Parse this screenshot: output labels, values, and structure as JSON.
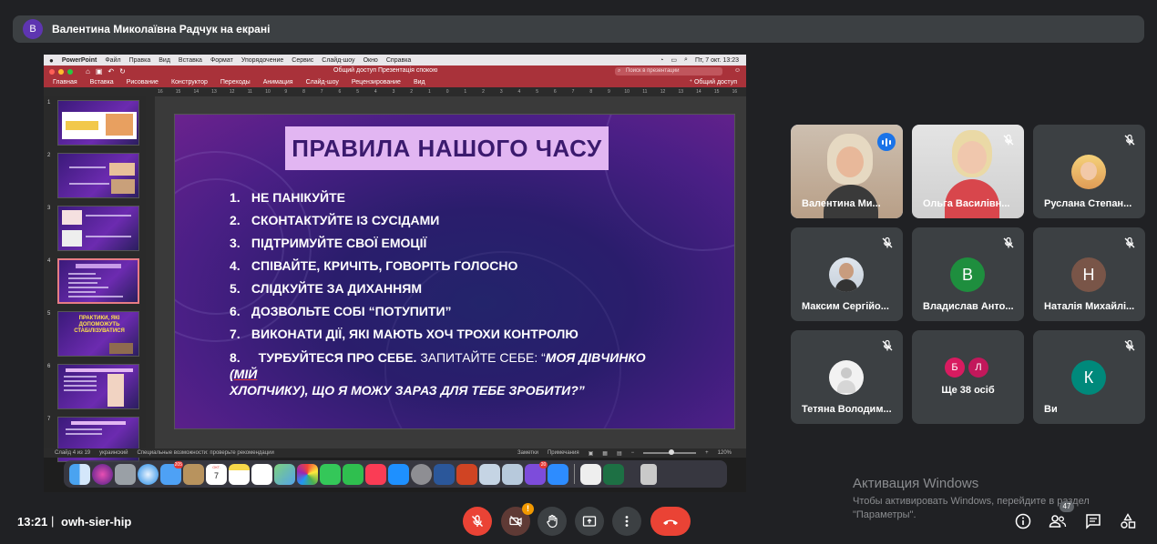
{
  "presenter": {
    "initial": "В",
    "label": "Валентина Миколаївна Радчук на екрані"
  },
  "mac_menu": {
    "app": "PowerPoint",
    "items": [
      "Файл",
      "Правка",
      "Вид",
      "Вставка",
      "Формат",
      "Упорядочение",
      "Сервис",
      "Слайд-шоу",
      "Окно",
      "Справка"
    ],
    "clock": "Пт, 7 окт. 13:23"
  },
  "ppt": {
    "doc_title": "Общий доступ Презентація спокою",
    "search_placeholder": "Поиск в презентации",
    "ribbon_tabs": [
      "Главная",
      "Вставка",
      "Рисование",
      "Конструктор",
      "Переходы",
      "Анимация",
      "Слайд-шоу",
      "Рецензирование",
      "Вид"
    ],
    "share_label": "Общий доступ",
    "ruler": [
      "16",
      "15",
      "14",
      "13",
      "12",
      "11",
      "10",
      "9",
      "8",
      "7",
      "6",
      "5",
      "4",
      "3",
      "2",
      "1",
      "0",
      "1",
      "2",
      "3",
      "4",
      "5",
      "6",
      "7",
      "8",
      "9",
      "10",
      "11",
      "12",
      "13",
      "14",
      "15",
      "16"
    ],
    "thumb_numbers": [
      "1",
      "2",
      "3",
      "4",
      "5",
      "6",
      "7"
    ],
    "thumb5_text": "ПРАКТИКИ, ЯКІ ДОПОМОЖУТЬ СТАБІЛІЗУВАТИСЯ",
    "status": {
      "slide": "Слайд 4 из 19",
      "language": "украинский",
      "accessibility": "Специальные возможности: проверьте рекомендации",
      "notes": "Заметки",
      "comments": "Примечания",
      "zoom": "120%"
    }
  },
  "slide": {
    "title": "ПРАВИЛА НАШОГО ЧАСУ",
    "items": [
      {
        "num": "1.",
        "text": "НЕ ПАНІКУЙТЕ"
      },
      {
        "num": "2.",
        "text": "СКОНТАКТУЙТЕ ІЗ СУСІДАМИ"
      },
      {
        "num": "3.",
        "text": "ПІДТРИМУЙТЕ СВОЇ ЕМОЦІЇ"
      },
      {
        "num": "4.",
        "text": "СПІВАЙТЕ, КРИЧІТЬ, ГОВОРІТЬ ГОЛОСНО"
      },
      {
        "num": "5.",
        "text": "СЛІДКУЙТЕ ЗА ДИХАННЯМ"
      },
      {
        "num": "6.",
        "text": "ДОЗВОЛЬТЕ СОБІ “ПОТУПИТИ”"
      },
      {
        "num": "7.",
        "text": "ВИКОНАТИ ДІЇ, ЯКІ МАЮТЬ ХОЧ ТРОХИ КОНТРОЛЮ"
      }
    ],
    "item8": {
      "num": "8.",
      "bold": "ТУРБУЙТЕСЯ ПРО СЕБЕ.",
      "normal": " ЗАПИТАЙТЕ СЕБЕ: “",
      "italic1": "МОЯ ДІВЧИНКО (",
      "italic_u": "МІЙ",
      "italic2": "ХЛОПЧИКУ), ЩО Я МОЖУ ЗАРАЗ ДЛЯ ТЕБЕ ЗРОБИТИ?”"
    }
  },
  "dock": {
    "icons": [
      "finder-icon",
      "siri-icon",
      "launchpad-icon",
      "safari-icon",
      "mail-icon",
      "contacts-icon",
      "calendar-icon",
      "notes-icon",
      "reminders-icon",
      "maps-icon",
      "photos-icon",
      "messages-icon",
      "facetime-icon",
      "music-icon",
      "appstore-icon",
      "settings-icon",
      "word-icon",
      "powerpoint-icon",
      "preview-icon",
      "finder2-icon",
      "viber-icon",
      "zoom-icon",
      "textedit-icon",
      "excel-icon",
      "trash-icon"
    ],
    "mail_badge": "205",
    "calendar_day": "7",
    "calendar_month": "ОКТ.",
    "viber_badge": "20"
  },
  "participants": [
    {
      "name": "Валентина Ми...",
      "speaking": true
    },
    {
      "name": "Ольга Василівн...",
      "muted": true
    },
    {
      "name": "Руслана Степан...",
      "muted": true
    },
    {
      "name": "Максим Сергійо...",
      "muted": true
    },
    {
      "name": "Владислав Анто...",
      "initial": "В",
      "color": "#1e8e3e",
      "muted": true
    },
    {
      "name": "Наталія Михайлі...",
      "initial": "Н",
      "color": "#795548",
      "muted": true
    },
    {
      "name": "Тетяна Володим...",
      "muted": true
    },
    {
      "more_label": "Ще 38 осіб",
      "avatars": [
        {
          "initial": "Б",
          "color": "#d81b60"
        },
        {
          "initial": "Л",
          "color": "#c2185b"
        }
      ]
    },
    {
      "name": "Ви",
      "initial": "К",
      "color": "#00897b",
      "muted": true
    }
  ],
  "activation": {
    "title": "Активация Windows",
    "line1": "Чтобы активировать Windows, перейдите в раздел",
    "line2": "\"Параметры\"."
  },
  "bottom": {
    "time": "13:21",
    "divider": "|",
    "meeting_code": "owh-sier-hip",
    "warning_badge": "!",
    "participants_count": "47"
  },
  "colors": {
    "background": "#202124",
    "tile": "#3c4043",
    "red": "#ea4335",
    "accent_blue": "#8ab4f8",
    "ppt_red": "#a9323a"
  }
}
